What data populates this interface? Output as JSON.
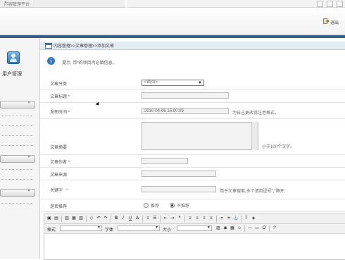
{
  "window": {
    "tab_title": "内容管理平台"
  },
  "header": {
    "exit_label": "退出"
  },
  "sidebar": {
    "user_mgmt_label": "用户管理"
  },
  "breadcrumb": "内容管理>>文章管理>>添加文章",
  "tip": {
    "icon": "i",
    "text": "提示: 带*的项目为必填信息。"
  },
  "form": {
    "category": {
      "label": "文章分类",
      "value": "<首页>"
    },
    "title": {
      "label": "文章标题",
      "required": "*"
    },
    "publish_time": {
      "label": "发布时间",
      "required": "*",
      "value": "2010-04-06 15:00:09",
      "hint": "为自己更改请注意格式。"
    },
    "summary": {
      "label": "文章摘要",
      "hint": "小于100个汉字。"
    },
    "author": {
      "label": "文章作者",
      "required": "*"
    },
    "source": {
      "label": "文章来源"
    },
    "keywords": {
      "label": "关键字",
      "required": "*",
      "hint": "用于文章搜索,多个请用逗号\",\"隔开."
    },
    "recommend": {
      "label": "是否推荐",
      "option_yes": "推荐",
      "option_no": "不推荐",
      "selected": "不推荐"
    }
  },
  "editor": {
    "format_label": "格式",
    "font_label": "字体",
    "size_label": "大小"
  },
  "icons": {
    "user_mgmt": "users-icon",
    "tip": "info-icon",
    "exit": "exit-icon",
    "breadcrumb": "window-icon"
  },
  "colors": {
    "banner": "#3a5f87",
    "crumb_bg": "#e4ecf3",
    "required": "#dd2222",
    "tip_icon": "#2d78c6"
  }
}
